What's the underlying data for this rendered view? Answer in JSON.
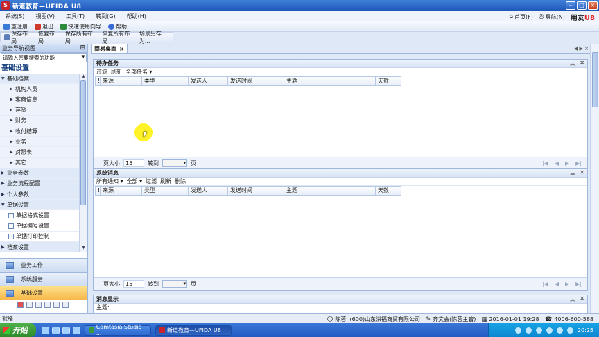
{
  "window": {
    "title": "新道教育—UFIDA U8",
    "app_icon": "S",
    "buttons": [
      "minimize",
      "maximize",
      "close"
    ]
  },
  "menubar": {
    "items": [
      "系统(S)",
      "视图(V)",
      "工具(T)",
      "转到(G)",
      "帮助(H)"
    ],
    "right": {
      "home": "首页(F)",
      "nav": "导航(N)",
      "brand": "用友",
      "brand_suffix": "U8"
    }
  },
  "toolbar1": {
    "items": [
      {
        "label": "重注册",
        "icon": "re-login-icon",
        "color": "#3a7ad8"
      },
      {
        "label": "退出",
        "icon": "exit-icon",
        "color": "#d03a2a"
      },
      {
        "label": "快速使用向导",
        "icon": "wizard-icon",
        "color": "#2c8a3c"
      },
      {
        "label": "帮助",
        "icon": "help-icon",
        "color": "#3a6ad8"
      }
    ]
  },
  "toolbar2": {
    "items": [
      {
        "label": "保存布局",
        "icon": "save-layout-icon"
      },
      {
        "label": "恢复布局"
      },
      {
        "label": "保存所有布局"
      },
      {
        "label": "恢复所有布局"
      },
      {
        "label": "场景另存为..."
      }
    ]
  },
  "nav": {
    "header": "业务导航视图",
    "search_placeholder": "请输入您要搜索的功能",
    "section_title": "基础设置",
    "tree": [
      {
        "label": "基础档案",
        "level": 0,
        "expanded": true
      },
      {
        "label": "机构人员",
        "level": 1
      },
      {
        "label": "客商信息",
        "level": 1
      },
      {
        "label": "存货",
        "level": 1
      },
      {
        "label": "财务",
        "level": 1
      },
      {
        "label": "收付结算",
        "level": 1
      },
      {
        "label": "业务",
        "level": 1
      },
      {
        "label": "对照表",
        "level": 1
      },
      {
        "label": "其它",
        "level": 1
      },
      {
        "label": "业务参数",
        "level": 0
      },
      {
        "label": "业务流程配置",
        "level": 0
      },
      {
        "label": "个人参数",
        "level": 0
      },
      {
        "label": "单据设置",
        "level": 0,
        "expanded": true
      },
      {
        "label": "单据格式设置",
        "level": 2
      },
      {
        "label": "单据编号设置",
        "level": 2
      },
      {
        "label": "单据打印控制",
        "level": 2
      },
      {
        "label": "档案设置",
        "level": 0
      }
    ],
    "big_tabs": [
      {
        "label": "业务工作",
        "active": false
      },
      {
        "label": "系统服务",
        "active": false
      },
      {
        "label": "基础设置",
        "active": true
      }
    ]
  },
  "main": {
    "tab_label": "简易桌面",
    "tasks_panel": {
      "title": "待办任务",
      "tools": [
        "过滤",
        "刷新",
        "全部任务 ▾"
      ],
      "columns": [
        "!",
        "来源",
        "类型",
        "发送人",
        "发送时间",
        "主题",
        "天数"
      ],
      "pager": {
        "page_size_label": "页大小",
        "page_size": "15",
        "goto_label": "转到",
        "page_unit": "页"
      }
    },
    "messages_panel": {
      "title": "系统消息",
      "tools": [
        "所有通知 ▾",
        "全部 ▾",
        "过滤",
        "刷新",
        "删除"
      ],
      "columns": [
        "!",
        "来源",
        "类型",
        "发送人",
        "发送时间",
        "主题",
        "天数"
      ],
      "pager": {
        "page_size_label": "页大小",
        "page_size": "15",
        "goto_label": "转到",
        "page_unit": "页"
      }
    },
    "display_panel": {
      "title": "消息显示",
      "subject_label": "主题:"
    }
  },
  "statusbar": {
    "ready": "就绪",
    "user": "陈蓉",
    "company": "(600)山东洪福商贸有限公司",
    "doc": "齐文会(陈蓉主管)",
    "datetime": "2016-01-01 19:28",
    "phone": "4006-600-588"
  },
  "taskbar": {
    "start": "开始",
    "tasks": [
      {
        "label": "Camtasia Studio ...",
        "active": false
      },
      {
        "label": "新道教育—UFIDA U8",
        "active": true
      }
    ],
    "clock": "20:25"
  },
  "colors": {
    "accent": "#1e56b8",
    "active_tab": "#f6b94a"
  }
}
